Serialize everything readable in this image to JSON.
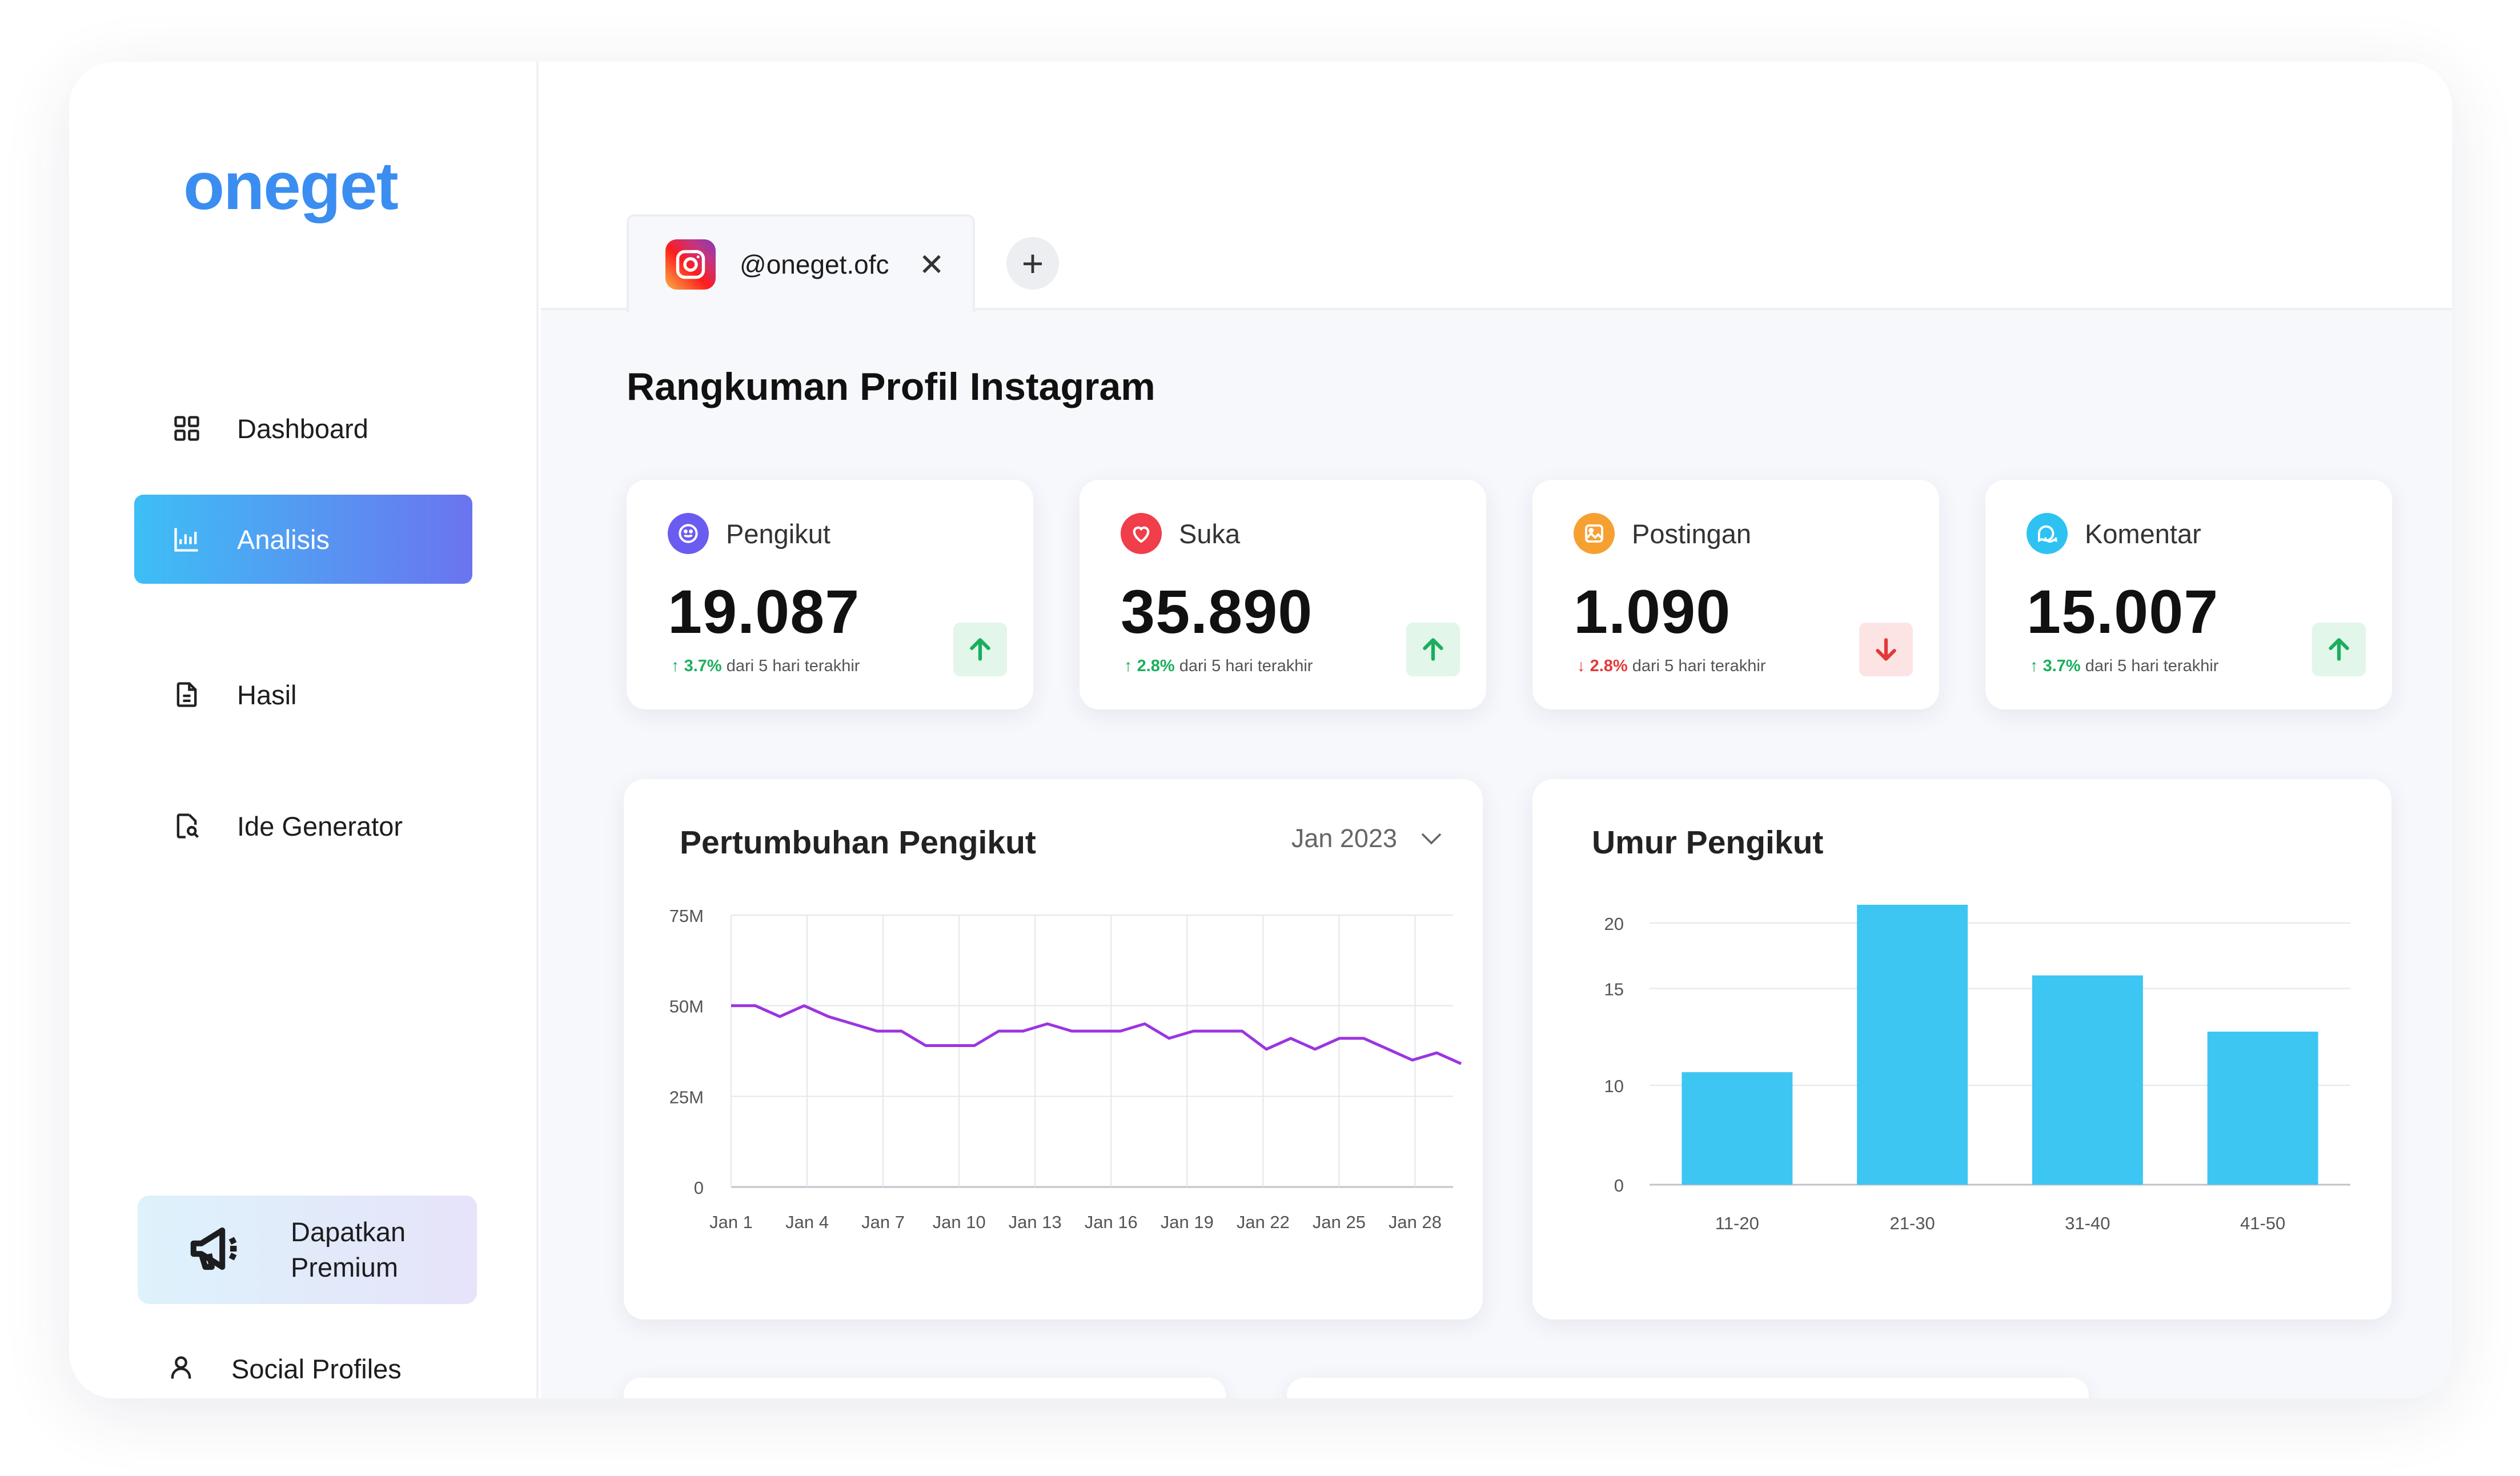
{
  "brand": {
    "logo_text": "oneget"
  },
  "sidebar": {
    "items": [
      {
        "label": "Dashboard",
        "icon": "grid-icon",
        "active": false
      },
      {
        "label": "Analisis",
        "icon": "chart-icon",
        "active": true
      },
      {
        "label": "Hasil",
        "icon": "document-icon",
        "active": false
      },
      {
        "label": "Ide Generator",
        "icon": "search-document-icon",
        "active": false
      }
    ],
    "premium": {
      "line1": "Dapatkan",
      "line2": "Premium",
      "icon": "megaphone-icon"
    },
    "social_profiles": {
      "label": "Social Profiles",
      "icon": "user-icon"
    }
  },
  "tabs": [
    {
      "label": "@oneget.ofc",
      "icon": "instagram-icon",
      "close_icon": "close-icon"
    }
  ],
  "add_tab": {
    "symbol": "+"
  },
  "page_title": "Rangkuman Profil Instagram",
  "stats": [
    {
      "label": "Pengikut",
      "value": "19.087",
      "change": "3.7%",
      "direction": "up",
      "note": "dari 5 hari terakhir",
      "icon": "smile-icon",
      "color": "#6a5cf0"
    },
    {
      "label": "Suka",
      "value": "35.890",
      "change": "2.8%",
      "direction": "up",
      "note": "dari 5 hari terakhir",
      "icon": "heart-icon",
      "color": "#f03e4a"
    },
    {
      "label": "Postingan",
      "value": "1.090",
      "change": "2.8%",
      "direction": "down",
      "note": "dari 5 hari terakhir",
      "icon": "image-icon",
      "color": "#f7a032"
    },
    {
      "label": "Komentar",
      "value": "15.007",
      "change": "3.7%",
      "direction": "up",
      "note": "dari 5 hari terakhir",
      "icon": "comment-icon",
      "color": "#2ec2f3"
    }
  ],
  "growth_card": {
    "title": "Pertumbuhan Pengikut",
    "period": "Jan 2023"
  },
  "age_card": {
    "title": "Umur Pengikut"
  },
  "chart_data": [
    {
      "type": "line",
      "title": "Pertumbuhan Pengikut",
      "x_tick_labels": [
        "Jan 1",
        "Jan 4",
        "Jan 7",
        "Jan 10",
        "Jan 13",
        "Jan 16",
        "Jan 19",
        "Jan 22",
        "Jan 25",
        "Jan 28"
      ],
      "y_tick_labels": [
        "0",
        "25M",
        "50M",
        "75M"
      ],
      "ylim": [
        0,
        75
      ],
      "x": [
        1,
        2,
        3,
        4,
        5,
        6,
        7,
        8,
        9,
        10,
        11,
        12,
        13,
        14,
        15,
        16,
        17,
        18,
        19,
        20,
        21,
        22,
        23,
        24,
        25,
        26,
        27,
        28,
        29,
        30,
        31
      ],
      "series": [
        {
          "values": [
            50,
            50,
            47,
            50,
            47,
            45,
            43,
            43,
            39,
            39,
            39,
            43,
            43,
            45,
            43,
            43,
            43,
            45,
            41,
            43,
            43,
            43,
            38,
            41,
            38,
            41,
            41,
            38,
            35,
            37,
            34
          ],
          "color": "#9b35e0"
        }
      ],
      "grid": true
    },
    {
      "type": "bar",
      "title": "Umur Pengikut",
      "categories": [
        "11-20",
        "21-30",
        "31-40",
        "41-50"
      ],
      "values": [
        8.6,
        21.4,
        16.0,
        11.7
      ],
      "y_tick_labels": [
        "0",
        "10",
        "15",
        "20"
      ],
      "color": "#3dc6f2",
      "grid": true
    }
  ]
}
